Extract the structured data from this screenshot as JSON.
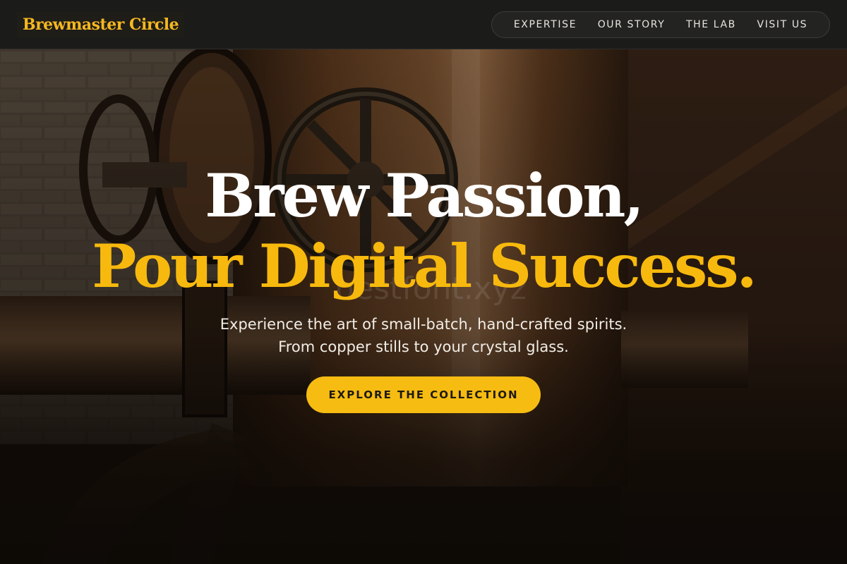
{
  "header": {
    "brand": "Brewmaster Circle",
    "nav": [
      "EXPERTISE",
      "OUR STORY",
      "THE LAB",
      "VISIT US"
    ]
  },
  "hero": {
    "headline_line1": "Brew Passion,",
    "headline_line2": "Pour Digital Success.",
    "watermark": "bestfont.xyz",
    "subtitle_line1": "Experience the art of small-batch, hand-crafted spirits.",
    "subtitle_line2": "From copper stills to your crystal glass.",
    "cta_label": "EXPLORE THE COLLECTION"
  },
  "colors": {
    "accent": "#f7b90d",
    "header_bg": "#1b1b1a",
    "copper": "#8a5a30"
  }
}
